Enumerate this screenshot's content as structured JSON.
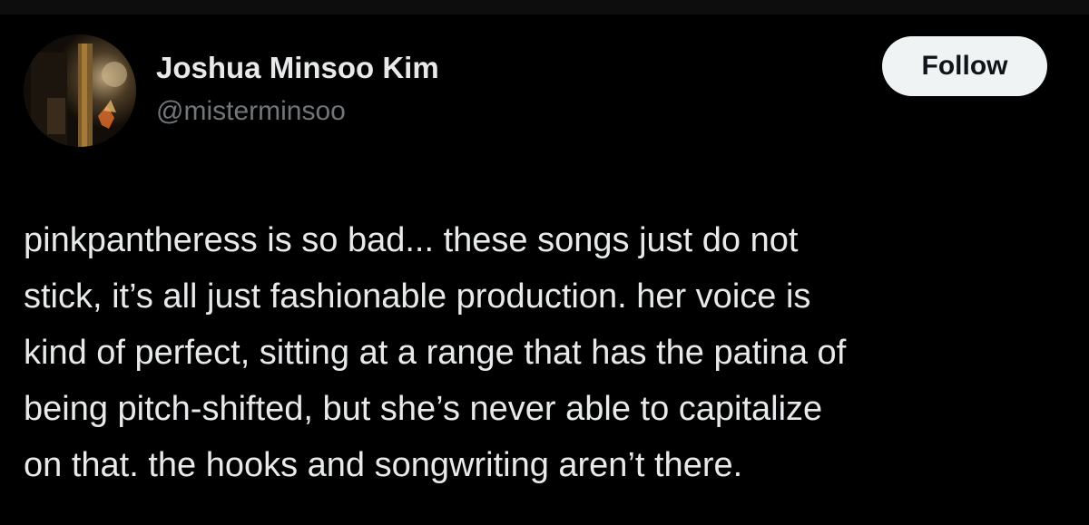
{
  "author": {
    "display_name": "Joshua Minsoo Kim",
    "handle": "@misterminsoo",
    "avatar_icon": "profile-photo"
  },
  "actions": {
    "follow_label": "Follow"
  },
  "tweet": {
    "lines": [
      "pinkpantheress is so bad... these songs just do not",
      "stick, it’s all just fashionable production. her voice is",
      "kind of perfect, sitting at a range that has the patina of",
      "being pitch-shifted, but she’s never able to capitalize",
      "on that. the hooks and songwriting aren’t there."
    ]
  },
  "colors": {
    "background": "#000000",
    "text_primary": "#e7e9ea",
    "text_secondary": "#71767b",
    "follow_bg": "#eff3f4",
    "follow_text": "#0f1419"
  }
}
